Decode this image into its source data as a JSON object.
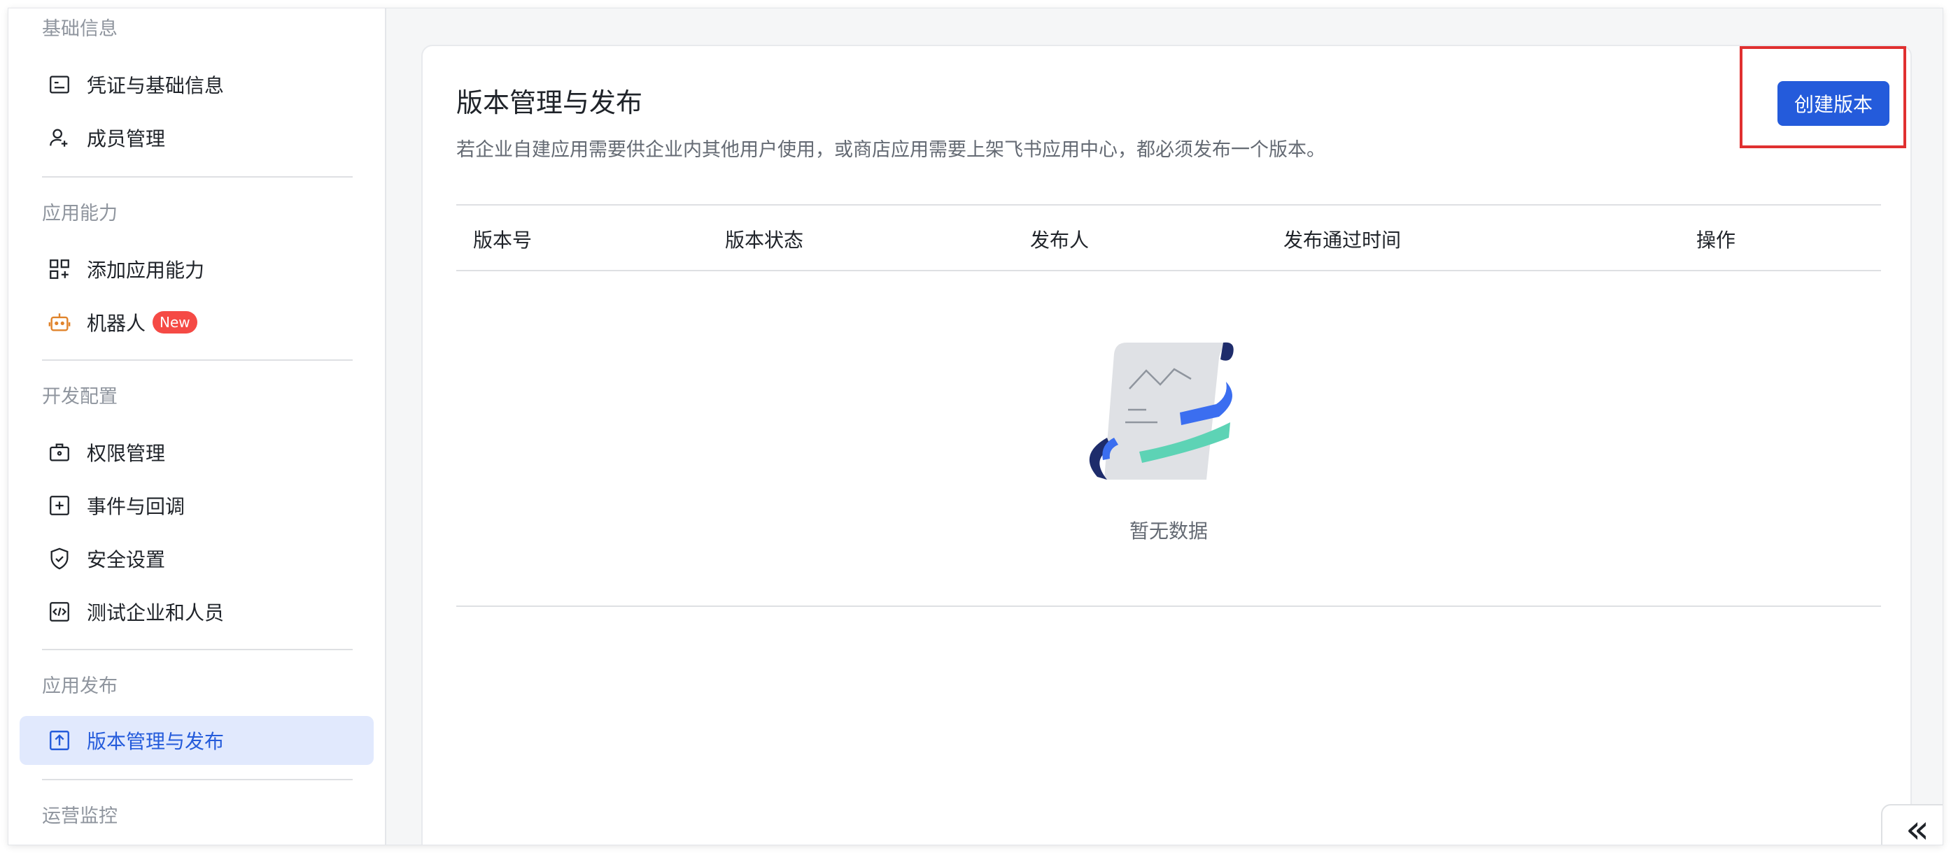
{
  "sidebar": {
    "groups": [
      {
        "title": "基础信息"
      },
      {
        "title": "应用能力"
      },
      {
        "title": "开发配置"
      },
      {
        "title": "应用发布"
      },
      {
        "title": "运营监控"
      }
    ],
    "items": [
      {
        "label": "凭证与基础信息",
        "icon": "credential-icon"
      },
      {
        "label": "成员管理",
        "icon": "user-add-icon"
      },
      {
        "label": "添加应用能力",
        "icon": "apps-add-icon"
      },
      {
        "label": "机器人",
        "icon": "robot-icon",
        "badge": "New"
      },
      {
        "label": "权限管理",
        "icon": "permission-icon"
      },
      {
        "label": "事件与回调",
        "icon": "event-add-icon"
      },
      {
        "label": "安全设置",
        "icon": "shield-check-icon"
      },
      {
        "label": "测试企业和人员",
        "icon": "code-icon"
      },
      {
        "label": "版本管理与发布",
        "icon": "upload-icon",
        "active": true
      }
    ]
  },
  "main": {
    "title": "版本管理与发布",
    "description": "若企业自建应用需要供企业内其他用户使用，或商店应用需要上架飞书应用中心，都必须发布一个版本。",
    "create_button": "创建版本",
    "table": {
      "columns": [
        "版本号",
        "版本状态",
        "发布人",
        "发布通过时间",
        "操作"
      ],
      "empty_text": "暂无数据"
    }
  },
  "collapse_button": "«",
  "colors": {
    "accent": "#245BDB",
    "active_bg": "#E1E9FD",
    "badge": "#F54A45",
    "highlight_border": "#E03030"
  }
}
